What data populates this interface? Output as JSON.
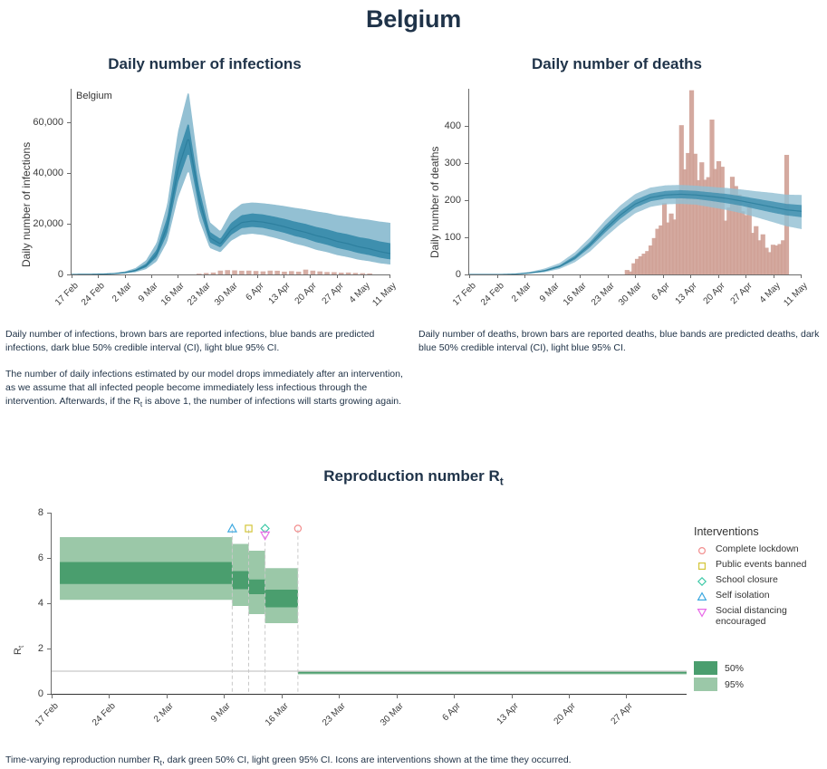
{
  "page": {
    "title": "Belgium"
  },
  "infections_panel": {
    "title": "Daily number of infections",
    "inner_label": "Belgium",
    "caption": "Daily number of infections, brown bars are reported infections, blue bands are predicted infections, dark blue 50% credible interval (CI), light blue 95% CI.",
    "caption2_a": "The number of daily infections estimated by our model drops immediately after an intervention, as we assume that all infected people become immediately less infectious through the intervention. Afterwards, if the R",
    "caption2_sub": "t",
    "caption2_b": " is above 1, the number of infections will starts growing again."
  },
  "deaths_panel": {
    "title": "Daily number of deaths",
    "caption": "Daily number of deaths, brown bars are reported deaths, blue bands are predicted deaths, dark blue 50% credible interval (CI), light blue 95% CI."
  },
  "rt_panel": {
    "title_main": "Reproduction number R",
    "title_sub": "t",
    "caption_a": "Time-varying reproduction number R",
    "caption_sub": "t",
    "caption_b": ", dark green 50% CI, light green 95% CI. Icons are interventions shown at the time they occurred."
  },
  "legend": {
    "title": "Interventions",
    "items": [
      {
        "label": "Complete lockdown",
        "icon": "circle-icon",
        "color": "#f28e8e"
      },
      {
        "label": "Public events banned",
        "icon": "square-icon",
        "color": "#d4c63a"
      },
      {
        "label": "School closure",
        "icon": "diamond-icon",
        "color": "#3ec9a7"
      },
      {
        "label": "Self isolation",
        "icon": "triangle-up-icon",
        "color": "#3fa9e0"
      },
      {
        "label": "Social distancing encouraged",
        "icon": "triangle-down-icon",
        "color": "#e86be8"
      }
    ],
    "bands": [
      {
        "label": "50%",
        "color": "#4a9e6e"
      },
      {
        "label": "95%",
        "color": "#9bc8a8"
      }
    ]
  },
  "colors": {
    "dark_blue": "#3e8fae",
    "light_blue": "#93c0d3",
    "bar_brown": "#cfa095",
    "dark_green": "#4a9e6e",
    "light_green": "#9bc8a8",
    "axis": "#6b6b6b",
    "title": "#1f3349"
  },
  "chart_data": [
    {
      "type": "area",
      "name": "daily-infections",
      "title": "Daily number of infections",
      "xlabel": "",
      "ylabel": "Daily number of infections",
      "ylim": [
        0,
        73000
      ],
      "yticks": [
        0,
        20000,
        40000,
        60000
      ],
      "ytick_labels": [
        "0",
        "20,000",
        "40,000",
        "60,000"
      ],
      "xticks": [
        "17 Feb",
        "24 Feb",
        "2 Mar",
        "9 Mar",
        "16 Mar",
        "23 Mar",
        "30 Mar",
        "6 Apr",
        "13 Apr",
        "20 Apr",
        "27 Apr",
        "4 May",
        "11 May"
      ],
      "grid": false,
      "legend_position": "none",
      "x": [
        "17 Feb",
        "20 Feb",
        "23 Feb",
        "26 Feb",
        "29 Feb",
        "2 Mar",
        "5 Mar",
        "8 Mar",
        "11 Mar",
        "14 Mar",
        "16 Mar",
        "17 Mar",
        "18 Mar",
        "19 Mar",
        "20 Mar",
        "22 Mar",
        "25 Mar",
        "28 Mar",
        "31 Mar",
        "3 Apr",
        "6 Apr",
        "10 Apr",
        "13 Apr",
        "17 Apr",
        "20 Apr",
        "24 Apr",
        "27 Apr",
        "1 May",
        "4 May",
        "8 May",
        "11 May"
      ],
      "series": [
        {
          "name": "median",
          "values": [
            20,
            40,
            80,
            160,
            330,
            700,
            1500,
            3400,
            8000,
            19000,
            41000,
            54000,
            30000,
            14500,
            12000,
            17500,
            20400,
            21000,
            20600,
            19800,
            18800,
            17600,
            16600,
            15300,
            14300,
            13000,
            12100,
            10900,
            10100,
            9000,
            8200
          ]
        },
        {
          "name": "ci50_low",
          "values": [
            15,
            32,
            65,
            130,
            270,
            570,
            1230,
            2800,
            6700,
            16000,
            36000,
            48000,
            26000,
            12600,
            10600,
            15500,
            18200,
            18700,
            18300,
            17400,
            16400,
            15100,
            14100,
            12700,
            11700,
            10400,
            9500,
            8400,
            7600,
            6600,
            5900
          ]
        },
        {
          "name": "ci50_high",
          "values": [
            26,
            52,
            104,
            205,
            420,
            880,
            1880,
            4200,
            9700,
            22500,
            47000,
            60000,
            34000,
            16800,
            14000,
            20200,
            23300,
            24000,
            23600,
            22800,
            21900,
            20800,
            19900,
            18700,
            17800,
            16600,
            15800,
            14700,
            14000,
            13000,
            12300
          ]
        },
        {
          "name": "ci95_low",
          "values": [
            9,
            20,
            42,
            86,
            180,
            390,
            870,
            2050,
            5100,
            12800,
            30000,
            41000,
            21500,
            10400,
            8700,
            13200,
            15600,
            16000,
            15500,
            14500,
            13400,
            12100,
            11100,
            9700,
            8800,
            7600,
            6800,
            5800,
            5200,
            4400,
            3900
          ]
        },
        {
          "name": "ci95_high",
          "values": [
            38,
            74,
            146,
            285,
            575,
            1180,
            2480,
            5500,
            12400,
            27500,
            56000,
            72500,
            41000,
            20600,
            17000,
            24600,
            27800,
            28300,
            28000,
            27500,
            26900,
            26200,
            25600,
            24800,
            24200,
            23300,
            22700,
            22000,
            21500,
            20800,
            20300
          ]
        }
      ],
      "bars": {
        "name": "reported infections",
        "color": "#cfa095",
        "x": [
          "21 Mar",
          "23 Mar",
          "25 Mar",
          "27 Mar",
          "29 Mar",
          "31 Mar",
          "2 Apr",
          "4 Apr",
          "6 Apr",
          "8 Apr",
          "10 Apr",
          "12 Apr",
          "14 Apr",
          "16 Apr",
          "18 Apr",
          "20 Apr",
          "22 Apr",
          "24 Apr",
          "26 Apr",
          "28 Apr",
          "30 Apr",
          "2 May",
          "4 May",
          "6 May",
          "8 May"
        ],
        "values": [
          300,
          560,
          750,
          1500,
          1700,
          1600,
          1450,
          1500,
          1350,
          1200,
          1500,
          1450,
          1100,
          1300,
          1100,
          1900,
          1500,
          1200,
          950,
          900,
          700,
          750,
          600,
          500,
          400
        ]
      }
    },
    {
      "type": "area",
      "name": "daily-deaths",
      "title": "Daily number of deaths",
      "xlabel": "",
      "ylabel": "Daily number of deaths",
      "ylim": [
        0,
        500
      ],
      "yticks": [
        0,
        100,
        200,
        300,
        400
      ],
      "ytick_labels": [
        "0",
        "100",
        "200",
        "300",
        "400"
      ],
      "xticks": [
        "17 Feb",
        "24 Feb",
        "2 Mar",
        "9 Mar",
        "16 Mar",
        "23 Mar",
        "30 Mar",
        "6 Apr",
        "13 Apr",
        "20 Apr",
        "27 Apr",
        "4 May",
        "11 May"
      ],
      "grid": false,
      "legend_position": "none",
      "x": [
        "17 Feb",
        "24 Feb",
        "2 Mar",
        "9 Mar",
        "16 Mar",
        "20 Mar",
        "23 Mar",
        "26 Mar",
        "29 Mar",
        "1 Apr",
        "4 Apr",
        "7 Apr",
        "10 Apr",
        "13 Apr",
        "16 Apr",
        "19 Apr",
        "22 Apr",
        "25 Apr",
        "28 Apr",
        "1 May",
        "4 May",
        "8 May",
        "11 May"
      ],
      "series": [
        {
          "name": "median",
          "values": [
            0,
            0,
            0,
            1,
            4,
            10,
            22,
            45,
            80,
            122,
            160,
            190,
            207,
            214,
            216,
            214,
            210,
            205,
            198,
            190,
            182,
            174,
            170
          ]
        },
        {
          "name": "ci50_low",
          "values": [
            0,
            0,
            0,
            0,
            3,
            8,
            19,
            40,
            73,
            113,
            150,
            180,
            197,
            204,
            205,
            203,
            198,
            192,
            185,
            176,
            167,
            159,
            154
          ]
        },
        {
          "name": "ci50_high",
          "values": [
            0,
            0,
            0,
            1,
            5,
            12,
            25,
            51,
            88,
            132,
            171,
            201,
            218,
            225,
            227,
            225,
            221,
            217,
            211,
            204,
            197,
            190,
            187
          ]
        },
        {
          "name": "ci95_low",
          "values": [
            0,
            0,
            0,
            0,
            2,
            6,
            15,
            33,
            62,
            100,
            135,
            165,
            182,
            189,
            190,
            188,
            181,
            174,
            165,
            154,
            142,
            130,
            122
          ]
        },
        {
          "name": "ci95_high",
          "values": [
            0,
            0,
            0,
            2,
            7,
            16,
            31,
            60,
            100,
            146,
            186,
            217,
            234,
            240,
            241,
            239,
            236,
            233,
            229,
            224,
            220,
            215,
            214
          ]
        }
      ],
      "bars": {
        "name": "reported deaths",
        "color": "#cfa095",
        "x": [
          "23 Mar",
          "24 Mar",
          "25 Mar",
          "26 Mar",
          "27 Mar",
          "28 Mar",
          "29 Mar",
          "30 Mar",
          "31 Mar",
          "1 Apr",
          "2 Apr",
          "3 Apr",
          "4 Apr",
          "5 Apr",
          "6 Apr",
          "7 Apr",
          "8 Apr",
          "9 Apr",
          "10 Apr",
          "11 Apr",
          "12 Apr",
          "13 Apr",
          "14 Apr",
          "15 Apr",
          "16 Apr",
          "17 Apr",
          "18 Apr",
          "19 Apr",
          "20 Apr",
          "21 Apr",
          "22 Apr",
          "23 Apr",
          "24 Apr",
          "25 Apr",
          "26 Apr",
          "27 Apr",
          "28 Apr",
          "29 Apr",
          "30 Apr",
          "1 May",
          "2 May",
          "3 May",
          "4 May",
          "5 May",
          "6 May",
          "7 May",
          "8 May",
          "9 May"
        ],
        "values": [
          12,
          8,
          30,
          42,
          49,
          56,
          63,
          78,
          98,
          123,
          132,
          192,
          140,
          164,
          148,
          205,
          402,
          283,
          327,
          496,
          325,
          254,
          302,
          255,
          262,
          417,
          284,
          305,
          290,
          145,
          180,
          263,
          238,
          215,
          170,
          160,
          190,
          112,
          130,
          92,
          108,
          72,
          60,
          80,
          78,
          82,
          92,
          322
        ]
      }
    },
    {
      "type": "area",
      "name": "reproduction-number",
      "title": "Reproduction number Rt",
      "xlabel": "",
      "ylabel": "Rt",
      "ylim": [
        0,
        8
      ],
      "yticks": [
        0,
        2,
        4,
        6,
        8
      ],
      "ytick_labels": [
        "0",
        "2",
        "4",
        "6",
        "8"
      ],
      "xticks": [
        "17 Feb",
        "24 Feb",
        "2 Mar",
        "9 Mar",
        "16 Mar",
        "23 Mar",
        "30 Mar",
        "6 Apr",
        "13 Apr",
        "20 Apr",
        "27 Apr"
      ],
      "grid": false,
      "reference_line_y": 1,
      "legend_position": "right",
      "steps": [
        {
          "from": "18 Feb",
          "to": "10 Mar",
          "median": 5.35,
          "ci50": [
            4.85,
            5.82
          ],
          "ci95": [
            4.15,
            6.92
          ]
        },
        {
          "from": "10 Mar",
          "to": "12 Mar",
          "median": 5.05,
          "ci50": [
            4.62,
            5.42
          ],
          "ci95": [
            3.88,
            6.62
          ]
        },
        {
          "from": "12 Mar",
          "to": "14 Mar",
          "median": 4.72,
          "ci50": [
            4.4,
            5.05
          ],
          "ci95": [
            3.52,
            6.32
          ]
        },
        {
          "from": "14 Mar",
          "to": "18 Mar",
          "median": 4.22,
          "ci50": [
            3.82,
            4.6
          ],
          "ci95": [
            3.12,
            5.55
          ]
        },
        {
          "from": "18 Mar",
          "to": "11 May",
          "median": 0.93,
          "ci50": [
            0.9,
            0.96
          ],
          "ci95": [
            0.86,
            1.0
          ]
        }
      ],
      "interventions": [
        {
          "label": "Self isolation",
          "date": "10 Mar",
          "icon": "triangle-up-icon",
          "color": "#3fa9e0",
          "y": 7.3
        },
        {
          "label": "Public events banned",
          "date": "12 Mar",
          "icon": "square-icon",
          "color": "#d4c63a",
          "y": 7.3
        },
        {
          "label": "School closure",
          "date": "14 Mar",
          "icon": "diamond-icon",
          "color": "#3ec9a7",
          "y": 7.3
        },
        {
          "label": "Social distancing encouraged",
          "date": "14 Mar",
          "icon": "triangle-down-icon",
          "color": "#e86be8",
          "y": 7.0
        },
        {
          "label": "Complete lockdown",
          "date": "18 Mar",
          "icon": "circle-icon",
          "color": "#f28e8e",
          "y": 7.3
        }
      ]
    }
  ]
}
